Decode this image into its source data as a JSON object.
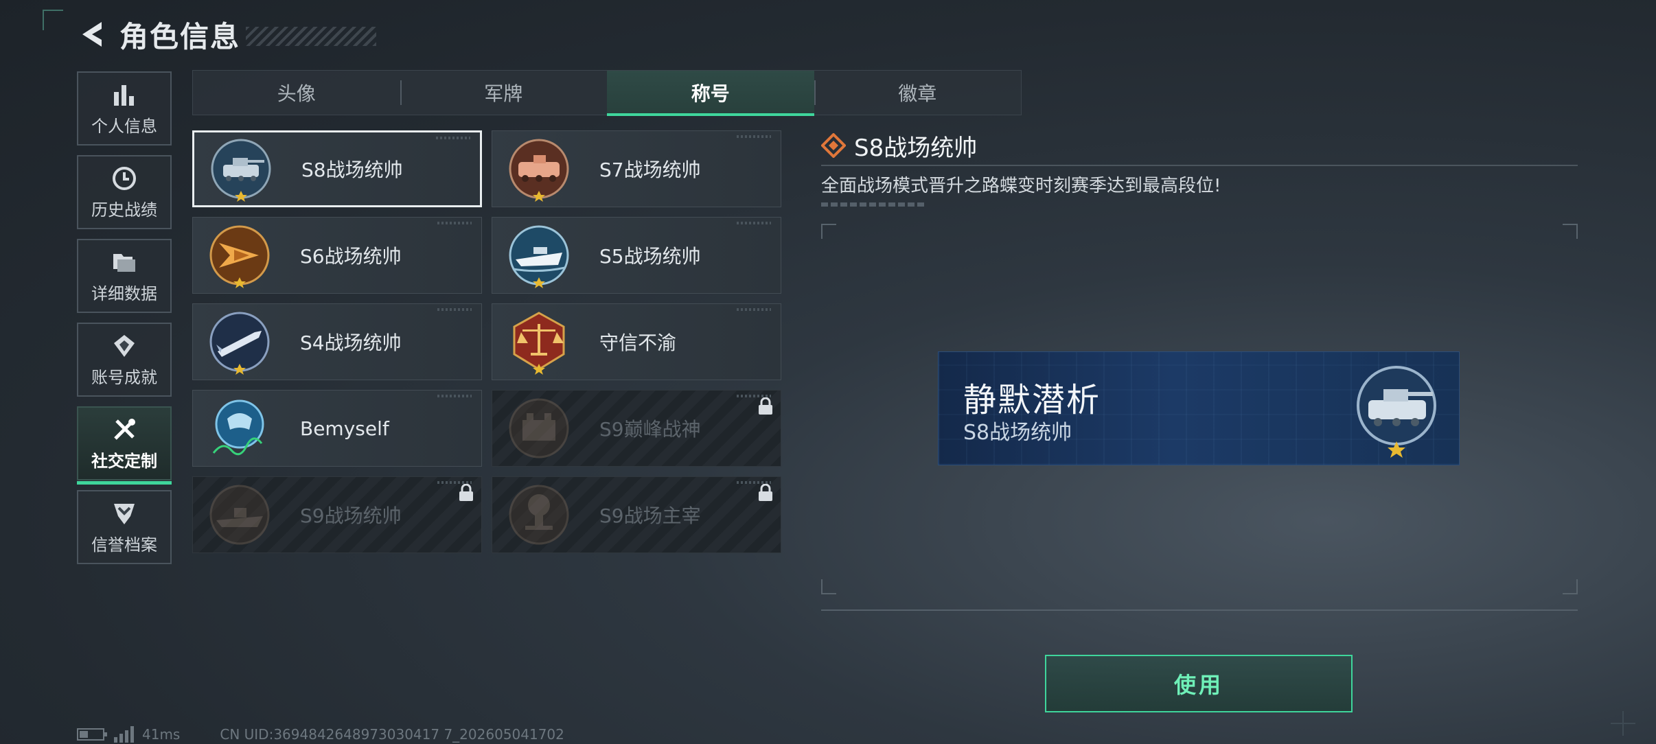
{
  "header": {
    "title": "角色信息"
  },
  "sidebar": {
    "items": [
      {
        "label": "个人信息",
        "icon": "bar-chart-icon",
        "active": false
      },
      {
        "label": "历史战绩",
        "icon": "clock-history-icon",
        "active": false
      },
      {
        "label": "详细数据",
        "icon": "folder-icon",
        "active": false
      },
      {
        "label": "账号成就",
        "icon": "achievement-icon",
        "active": false
      },
      {
        "label": "社交定制",
        "icon": "tools-icon",
        "active": true
      },
      {
        "label": "信誉档案",
        "icon": "shield-chevron-icon",
        "active": false
      }
    ]
  },
  "tabs": [
    {
      "label": "头像",
      "active": false
    },
    {
      "label": "军牌",
      "active": false
    },
    {
      "label": "称号",
      "active": true
    },
    {
      "label": "徽章",
      "active": false
    }
  ],
  "titles": [
    {
      "label": "S8战场统帅",
      "emblem": "tank-emblem-icon",
      "color": "#5b86a8",
      "selected": true,
      "locked": false
    },
    {
      "label": "S7战场统帅",
      "emblem": "apc-emblem-icon",
      "color": "#c9826a",
      "selected": false,
      "locked": false
    },
    {
      "label": "S6战场统帅",
      "emblem": "jet-emblem-icon",
      "color": "#b8732f",
      "selected": false,
      "locked": false
    },
    {
      "label": "S5战场统帅",
      "emblem": "boat-emblem-icon",
      "color": "#4f8db0",
      "selected": false,
      "locked": false
    },
    {
      "label": "S4战场统帅",
      "emblem": "missile-emblem-icon",
      "color": "#3f5f8a",
      "selected": false,
      "locked": false
    },
    {
      "label": "守信不渝",
      "emblem": "scales-emblem-icon",
      "color": "#a8382a",
      "selected": false,
      "locked": false
    },
    {
      "label": "Bemyself",
      "emblem": "signature-emblem-icon",
      "color": "#2f7fb0",
      "selected": false,
      "locked": false
    },
    {
      "label": "S9巅峰战神",
      "emblem": "fortress-emblem-icon",
      "color": "#6e5a4a",
      "selected": false,
      "locked": true
    },
    {
      "label": "S9战场统帅",
      "emblem": "warship-emblem-icon",
      "color": "#6e5a4a",
      "selected": false,
      "locked": true
    },
    {
      "label": "S9战场主宰",
      "emblem": "explosion-emblem-icon",
      "color": "#6e5a4a",
      "selected": false,
      "locked": true
    }
  ],
  "detail": {
    "title": "S8战场统帅",
    "description": "全面战场模式晋升之路蝶变时刻赛季达到最高段位!",
    "accent": "#e0773a"
  },
  "nameplate": {
    "player_name": "静默潜析",
    "title": "S8战场统帅"
  },
  "actions": {
    "use_label": "使用"
  },
  "status": {
    "ping": "41ms",
    "uid": "CN UID:3694842648973030417 7_202605041702"
  },
  "colors": {
    "accent_green": "#3fd69c",
    "panel_bg": "#2c343b"
  }
}
